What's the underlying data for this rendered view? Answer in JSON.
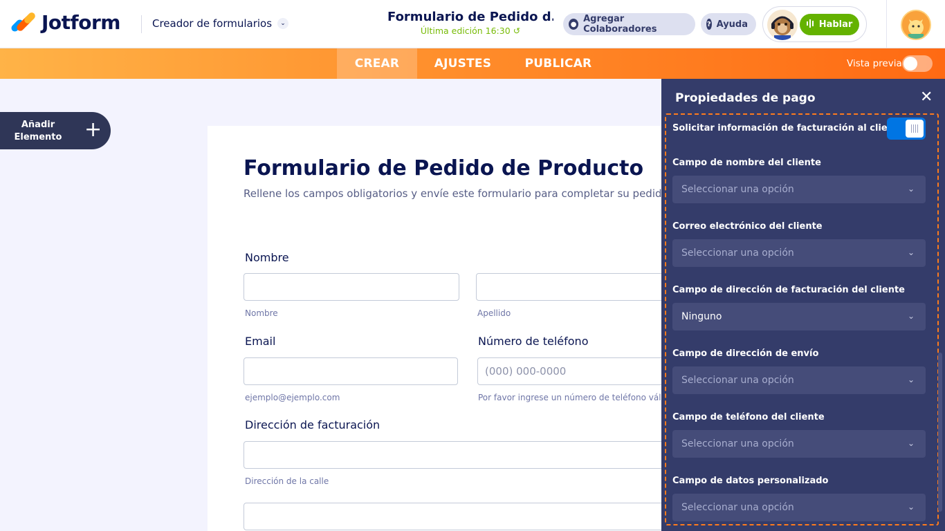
{
  "header": {
    "logo_text": "Jotform",
    "builder_label": "Creador de formularios",
    "form_title": "Formulario de Pedido d...",
    "last_edited": "Última edición 16:30",
    "collaborators_label": "Agregar Colaboradores",
    "help_label": "Ayuda",
    "talk_label": "Hablar"
  },
  "nav": {
    "tabs": [
      {
        "label": "CREAR",
        "active": true
      },
      {
        "label": "AJUSTES",
        "active": false
      },
      {
        "label": "PUBLICAR",
        "active": false
      }
    ],
    "preview_label": "Vista previa",
    "preview_on": false
  },
  "sidebar": {
    "add_element_label_1": "Añadir",
    "add_element_label_2": "Elemento"
  },
  "form": {
    "title": "Formulario de Pedido de Producto",
    "subtitle": "Rellene los campos obligatorios y envíe este formulario para completar su pedido.",
    "name_label": "Nombre",
    "first_name_help": "Nombre",
    "last_name_help": "Apellido",
    "email_label": "Email",
    "email_help": "ejemplo@ejemplo.com",
    "phone_label": "Número de teléfono",
    "phone_placeholder": "(000) 000-0000",
    "phone_help": "Por favor ingrese un número de teléfono válido.",
    "billing_label": "Dirección de facturación",
    "street_help": "Dirección de la calle"
  },
  "panel": {
    "title": "Propiedades de pago",
    "request_billing_label": "Solicitar información de facturación al cliente",
    "request_billing_on": true,
    "fields": [
      {
        "label": "Campo de nombre del cliente",
        "value": "Seleccionar una opción",
        "filled": false
      },
      {
        "label": "Correo electrónico del cliente",
        "value": "Seleccionar una opción",
        "filled": false
      },
      {
        "label": "Campo de dirección de facturación del cliente",
        "value": "Ninguno",
        "filled": true
      },
      {
        "label": "Campo de dirección de envío",
        "value": "Seleccionar una opción",
        "filled": false
      },
      {
        "label": "Campo de teléfono del cliente",
        "value": "Seleccionar una opción",
        "filled": false
      },
      {
        "label": "Campo de datos personalizado",
        "value": "Seleccionar una opción",
        "filled": false
      }
    ]
  },
  "colors": {
    "brand_navy": "#0a1551",
    "nav_orange": "#ff7b1c",
    "panel_bg": "#343c6a",
    "toggle_blue": "#0075e3",
    "talk_green": "#64b200",
    "edit_green": "#78bb07"
  },
  "icons": [
    "jotform-logo-icon",
    "chevron-down-icon",
    "user-icon",
    "help-icon",
    "agent-avatar",
    "voice-icon",
    "user-avatar",
    "plus-icon",
    "close-icon",
    "caret-down-icon",
    "refresh-icon"
  ]
}
